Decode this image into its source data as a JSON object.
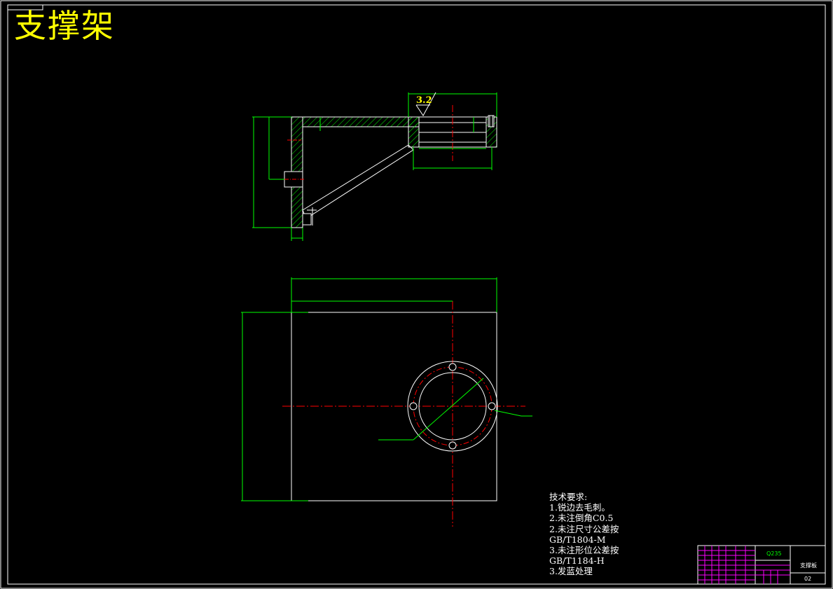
{
  "title": "支撑架",
  "roughness": "3.2",
  "colors": {
    "background": "#000000",
    "outline": "#ffffff",
    "dimension": "#00ff00",
    "centerline": "#ff0000",
    "hatch": "#00ff00",
    "title": "#ffff00",
    "titleblock_grid": "#ff00ff"
  },
  "technical_requirements": {
    "heading": "技术要求:",
    "items": [
      "1.锐边去毛刺。",
      "2.未注倒角C0.5",
      "2.未注尺寸公差按",
      "GB/T1804-M",
      "3.未注形位公差按",
      "GB/T1184-H",
      "3.发蓝处理"
    ]
  },
  "title_block": {
    "material": "Q235",
    "part_name": "支撑板",
    "drawing_no": "02"
  }
}
